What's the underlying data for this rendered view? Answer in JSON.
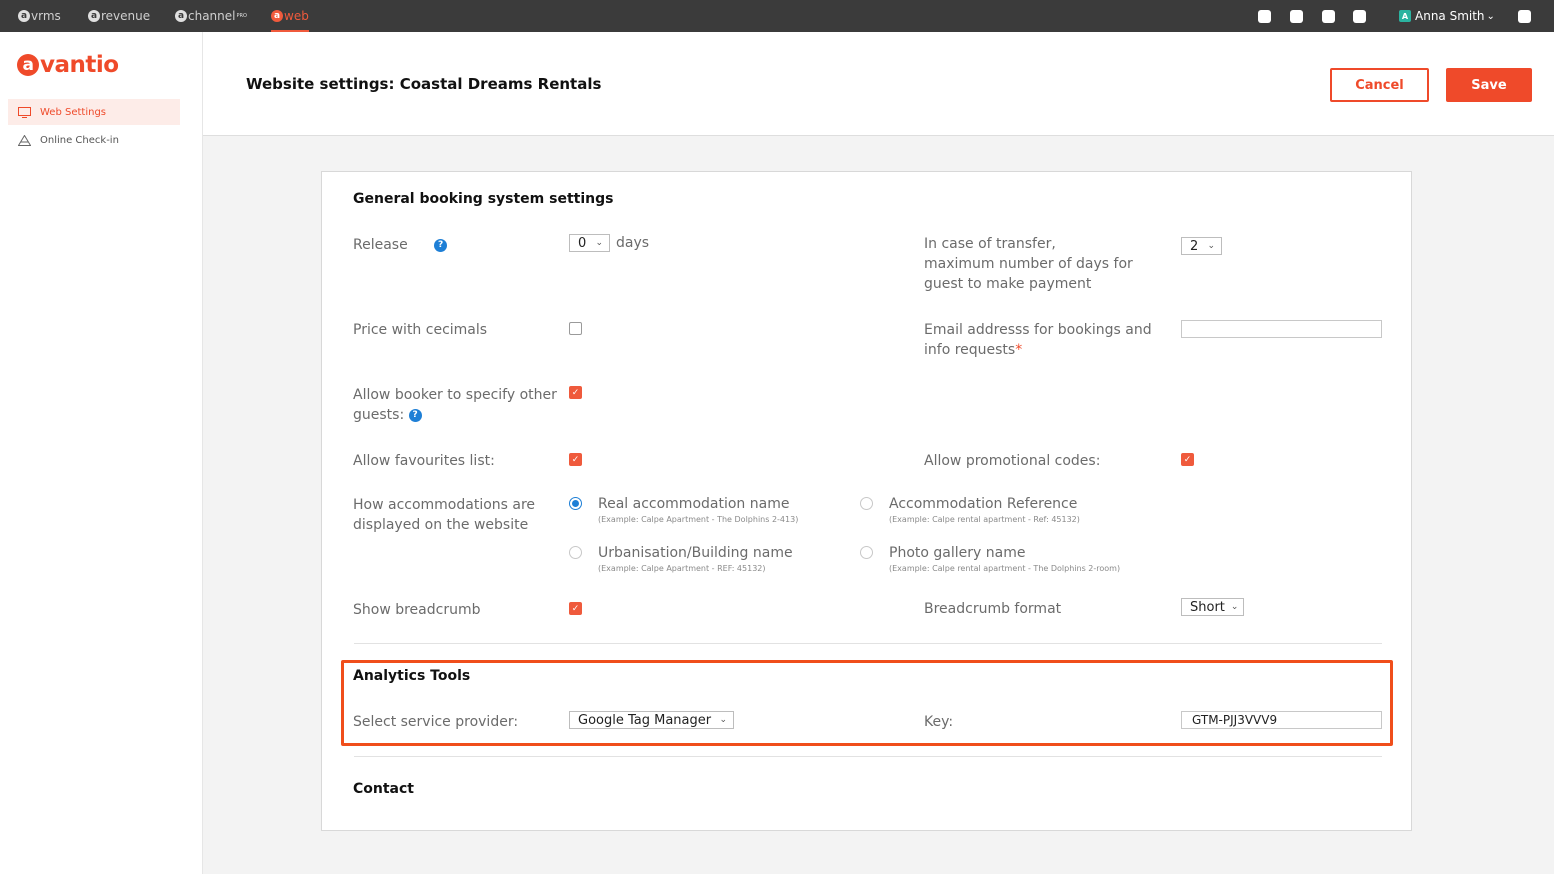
{
  "topbar": {
    "apps": [
      {
        "badge": "a",
        "label": "vrms"
      },
      {
        "badge": "a",
        "label": "revenue"
      },
      {
        "badge": "a",
        "label": "channel",
        "sup": "PRO"
      },
      {
        "badge": "a",
        "label": "web"
      }
    ],
    "user": {
      "avatar": "A",
      "name": "Anna Smith"
    }
  },
  "sidebar": {
    "logo": {
      "mark": "a",
      "text": "vantio"
    },
    "items": [
      {
        "label": "Web Settings",
        "icon": "monitor-icon"
      },
      {
        "label": "Online Check-in",
        "icon": "cabin-icon"
      }
    ]
  },
  "header": {
    "title": "Website settings: Coastal Dreams Rentals",
    "cancel_label": "Cancel",
    "save_label": "Save"
  },
  "general": {
    "title": "General booking system settings",
    "release_label": "Release",
    "release_value": "0",
    "release_unit": "days",
    "transfer_label_1": "In case of transfer,",
    "transfer_label_2": "maximum number of days for",
    "transfer_label_3": "guest to make payment",
    "transfer_value": "2",
    "price_decimals_label": "Price with cecimals",
    "price_decimals_checked": false,
    "email_label_1": "Email addresss for bookings and",
    "email_label_2": "info requests",
    "email_required": "*",
    "email_value": "",
    "other_guests_label_1": "Allow booker to specify other",
    "other_guests_label_2": "guests:",
    "other_guests_checked": true,
    "favourites_label": "Allow favourites list:",
    "favourites_checked": true,
    "promo_label": "Allow promotional codes:",
    "promo_checked": true,
    "display_label_1": "How accommodations are",
    "display_label_2": "displayed on the website",
    "display_options": [
      {
        "label": "Real accommodation name",
        "example": "(Example: Calpe Apartment - The Dolphins 2-413)",
        "selected": true
      },
      {
        "label": "Accommodation Reference",
        "example": "(Example: Calpe rental apartment - Ref: 45132)",
        "selected": false
      },
      {
        "label": "Urbanisation/Building name",
        "example": "(Example: Calpe Apartment - REF: 45132)",
        "selected": false
      },
      {
        "label": "Photo gallery name",
        "example": "(Example: Calpe rental apartment - The Dolphins 2-room)",
        "selected": false
      }
    ],
    "breadcrumb_label": "Show breadcrumb",
    "breadcrumb_checked": true,
    "breadcrumb_format_label": "Breadcrumb format",
    "breadcrumb_format_value": "Short"
  },
  "analytics": {
    "title": "Analytics Tools",
    "provider_label": "Select service provider:",
    "provider_value": "Google Tag Manager",
    "key_label": "Key:",
    "key_value": "GTM-PJJ3VVV9"
  },
  "contact": {
    "title": "Contact"
  },
  "colors": {
    "brand": "#ef4a2a",
    "highlight": "#f04e1b",
    "radio": "#1e7fd6"
  }
}
